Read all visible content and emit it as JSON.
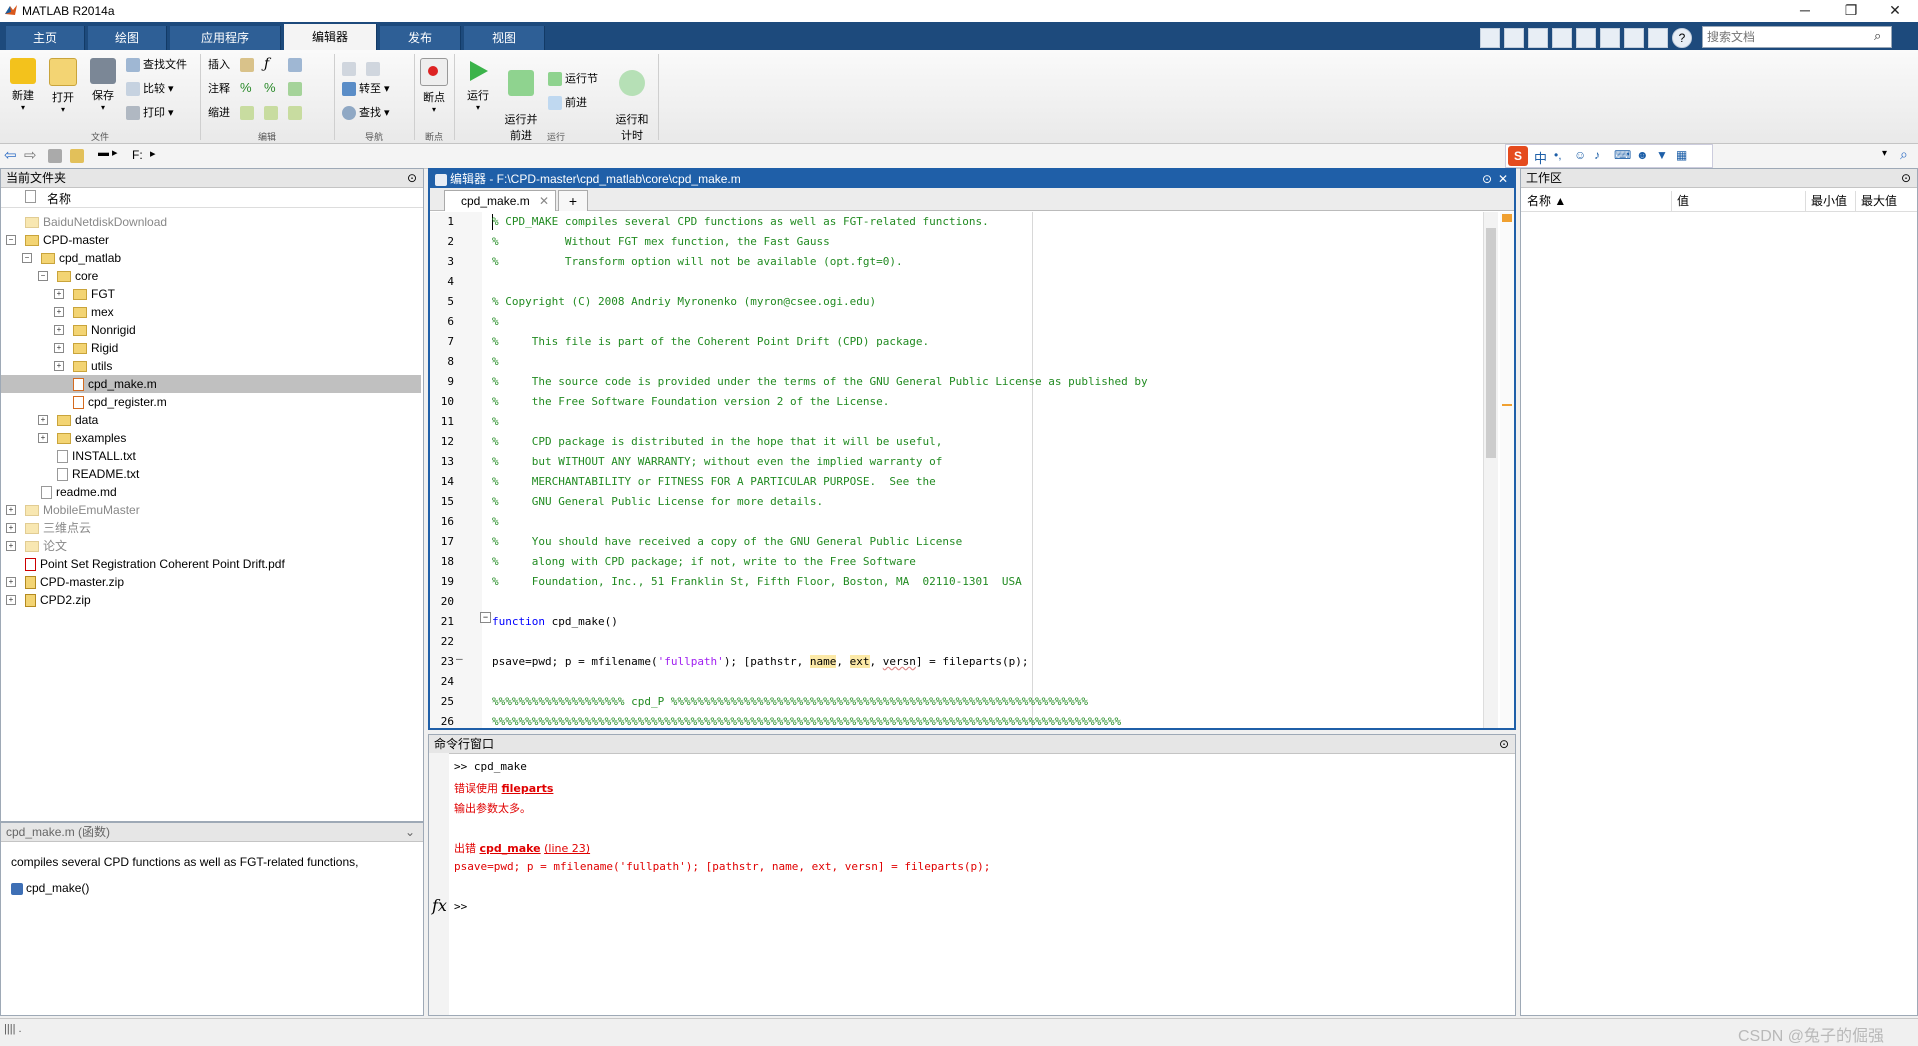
{
  "window": {
    "title": "MATLAB R2014a",
    "min": "─",
    "max": "❐",
    "close": "✕"
  },
  "ribbon_tabs": [
    "主页",
    "绘图",
    "应用程序",
    "编辑器",
    "发布",
    "视图"
  ],
  "search_docs": {
    "placeholder": "搜索文档"
  },
  "ribbon": {
    "new": "新建",
    "open": "打开",
    "save": "保存",
    "find_files": "查找文件",
    "compare": "比较",
    "print": "打印",
    "insert": "插入",
    "comment": "注释",
    "indent": "缩进",
    "goto": "转至",
    "find": "查找",
    "breakpoints": "断点",
    "run": "运行",
    "run_advance": "运行并\n前进",
    "run_section": "运行节",
    "advance": "前进",
    "run_time": "运行和\n计时",
    "groups": {
      "file": "文件",
      "edit": "编辑",
      "navigate": "导航",
      "breakpoints": "断点",
      "run": "运行"
    }
  },
  "address": {
    "path": "F:"
  },
  "current_folder": {
    "title": "当前文件夹",
    "col_name": "名称",
    "items": [
      {
        "label": "BaiduNetdiskDownload"
      },
      {
        "label": "CPD-master"
      },
      {
        "label": "cpd_matlab"
      },
      {
        "label": "core"
      },
      {
        "label": "FGT"
      },
      {
        "label": "mex"
      },
      {
        "label": "Nonrigid"
      },
      {
        "label": "Rigid"
      },
      {
        "label": "utils"
      },
      {
        "label": "cpd_make.m"
      },
      {
        "label": "cpd_register.m"
      },
      {
        "label": "data"
      },
      {
        "label": "examples"
      },
      {
        "label": "INSTALL.txt"
      },
      {
        "label": "README.txt"
      },
      {
        "label": "readme.md"
      },
      {
        "label": "MobileEmuMaster"
      },
      {
        "label": "三维点云"
      },
      {
        "label": "论文"
      },
      {
        "label": "Point Set Registration Coherent Point Drift.pdf"
      },
      {
        "label": "CPD-master.zip"
      },
      {
        "label": "CPD2.zip"
      }
    ]
  },
  "details": {
    "title": "cpd_make.m (函数)",
    "desc": "compiles several CPD functions as well as FGT-related functions,",
    "fn": "cpd_make()"
  },
  "editor": {
    "title": "编辑器 - F:\\CPD-master\\cpd_matlab\\core\\cpd_make.m",
    "tab": "cpd_make.m",
    "add_tab": "+",
    "lines": [
      "% CPD_MAKE compiles several CPD functions as well as FGT-related functions.",
      "%          Without FGT mex function, the Fast Gauss",
      "%          Transform option will not be available (opt.fgt=0).",
      "",
      "% Copyright (C) 2008 Andriy Myronenko (myron@csee.ogi.edu)",
      "%",
      "%     This file is part of the Coherent Point Drift (CPD) package.",
      "%",
      "%     The source code is provided under the terms of the GNU General Public License as published by",
      "%     the Free Software Foundation version 2 of the License.",
      "%",
      "%     CPD package is distributed in the hope that it will be useful,",
      "%     but WITHOUT ANY WARRANTY; without even the implied warranty of",
      "%     MERCHANTABILITY or FITNESS FOR A PARTICULAR PURPOSE.  See the",
      "%     GNU General Public License for more details.",
      "%",
      "%     You should have received a copy of the GNU General Public License",
      "%     along with CPD package; if not, write to the Free Software",
      "%     Foundation, Inc., 51 Franklin St, Fifth Floor, Boston, MA  02110-1301  USA",
      "",
      "function cpd_make()",
      "",
      "psave=pwd; p = mfilename('fullpath'); [pathstr, name, ext, versn] = fileparts(p);",
      "",
      "%%%%%%%%%%%%%%%%%%%% cpd_P %%%%%%%%%%%%%%%%%%%%%%%%%%%%%%%%%%%%%%%%%%%%%%%%%%%%%%%%%%%%%%%",
      "%%%%%%%%%%%%%%%%%%%%%%%%%%%%%%%%%%%%%%%%%%%%%%%%%%%%%%%%%%%%%%%%%%%%%%%%%%%%%%%%%%%%%%%%%%%%%%%"
    ],
    "line_numbers": [
      "1",
      "2",
      "3",
      "4",
      "5",
      "6",
      "7",
      "8",
      "9",
      "10",
      "11",
      "12",
      "13",
      "14",
      "15",
      "16",
      "17",
      "18",
      "19",
      "20",
      "21",
      "22",
      "23",
      "24",
      "25",
      "26"
    ],
    "fold_mark": "−",
    "warn_mark": "–"
  },
  "command_window": {
    "title": "命令行窗口",
    "prompt_cmd": ">> cpd_make",
    "err1_prefix": "错误使用 ",
    "err1_link": "fileparts",
    "err1_msg": "输出参数太多。",
    "err2_prefix": "出错 ",
    "err2_link": "cpd_make",
    "err2_line": "(line 23)",
    "err2_code": "psave=pwd; p = mfilename('fullpath'); [pathstr, name, ext, versn] = fileparts(p);",
    "fx": "fx",
    "prompt": ">>"
  },
  "workspace": {
    "title": "工作区",
    "cols": [
      "名称 ▲",
      "值",
      "最小值",
      "最大值"
    ]
  },
  "watermark": "CSDN @兔子的倔强",
  "status": {
    "text": "|||| ."
  }
}
